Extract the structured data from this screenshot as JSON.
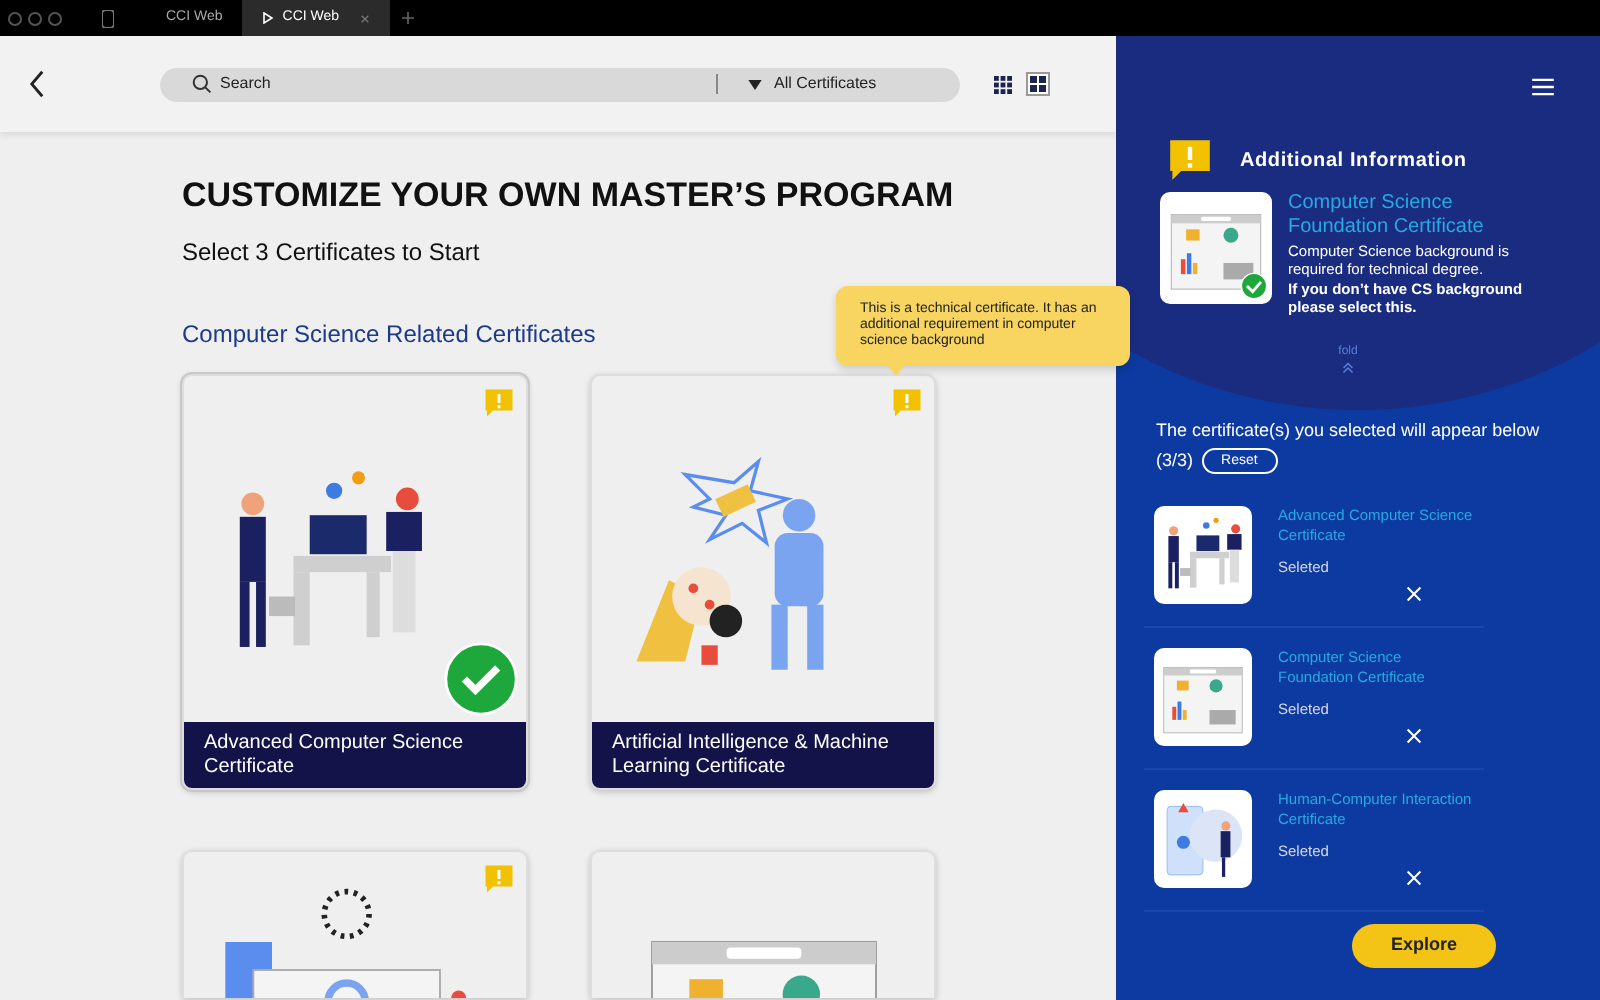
{
  "browser_tabs": [
    {
      "label": "CCI Web",
      "selected": false
    },
    {
      "label": "CCI Web",
      "selected": true
    }
  ],
  "search": {
    "placeholder": "Search"
  },
  "filter": {
    "value": "All Certificates"
  },
  "view_modes": [
    {
      "kind": "list",
      "selected": false
    },
    {
      "kind": "tiles",
      "selected": true
    }
  ],
  "heading": "CUSTOMIZE YOUR OWN MASTER’S PROGRAM",
  "subheading": "Select 3 Certificates to Start",
  "section_title": "Computer Science Related Certificates",
  "tooltip": "This is a technical certificate. It has an additional requirement in computer science background",
  "certificates": [
    {
      "title": "Advanced Computer Science Certificate",
      "kind": "team",
      "selected": true,
      "warning": true
    },
    {
      "title": "Artificial Intelligence & Machine Learning Certificate",
      "kind": "ai",
      "selected": false,
      "warning": true
    },
    {
      "kind": "security",
      "selected": false,
      "warning": true
    },
    {
      "kind": "browser",
      "selected": false,
      "warning": false
    }
  ],
  "panel": {
    "info_title": "Additional Information",
    "info_cert_title": "Computer Science Foundation Certificate",
    "info_text": "Computer Science background is required for technical degree.",
    "info_note": "If you don’t have CS background please select this.",
    "fold_label": "fold",
    "selected_intro": "The certificate(s) you selected will appear below",
    "count": "(3/3)",
    "reset": "Reset",
    "selected": [
      {
        "title": "Advanced Computer Science Certificate",
        "status": "Seleted",
        "kind": "team"
      },
      {
        "title": "Computer Science Foundation Certificate",
        "status": "Seleted",
        "kind": "browser"
      },
      {
        "title": "Human-Computer Interaction Certificate",
        "status": "Seleted",
        "kind": "hci"
      }
    ],
    "explore": "Explore"
  }
}
